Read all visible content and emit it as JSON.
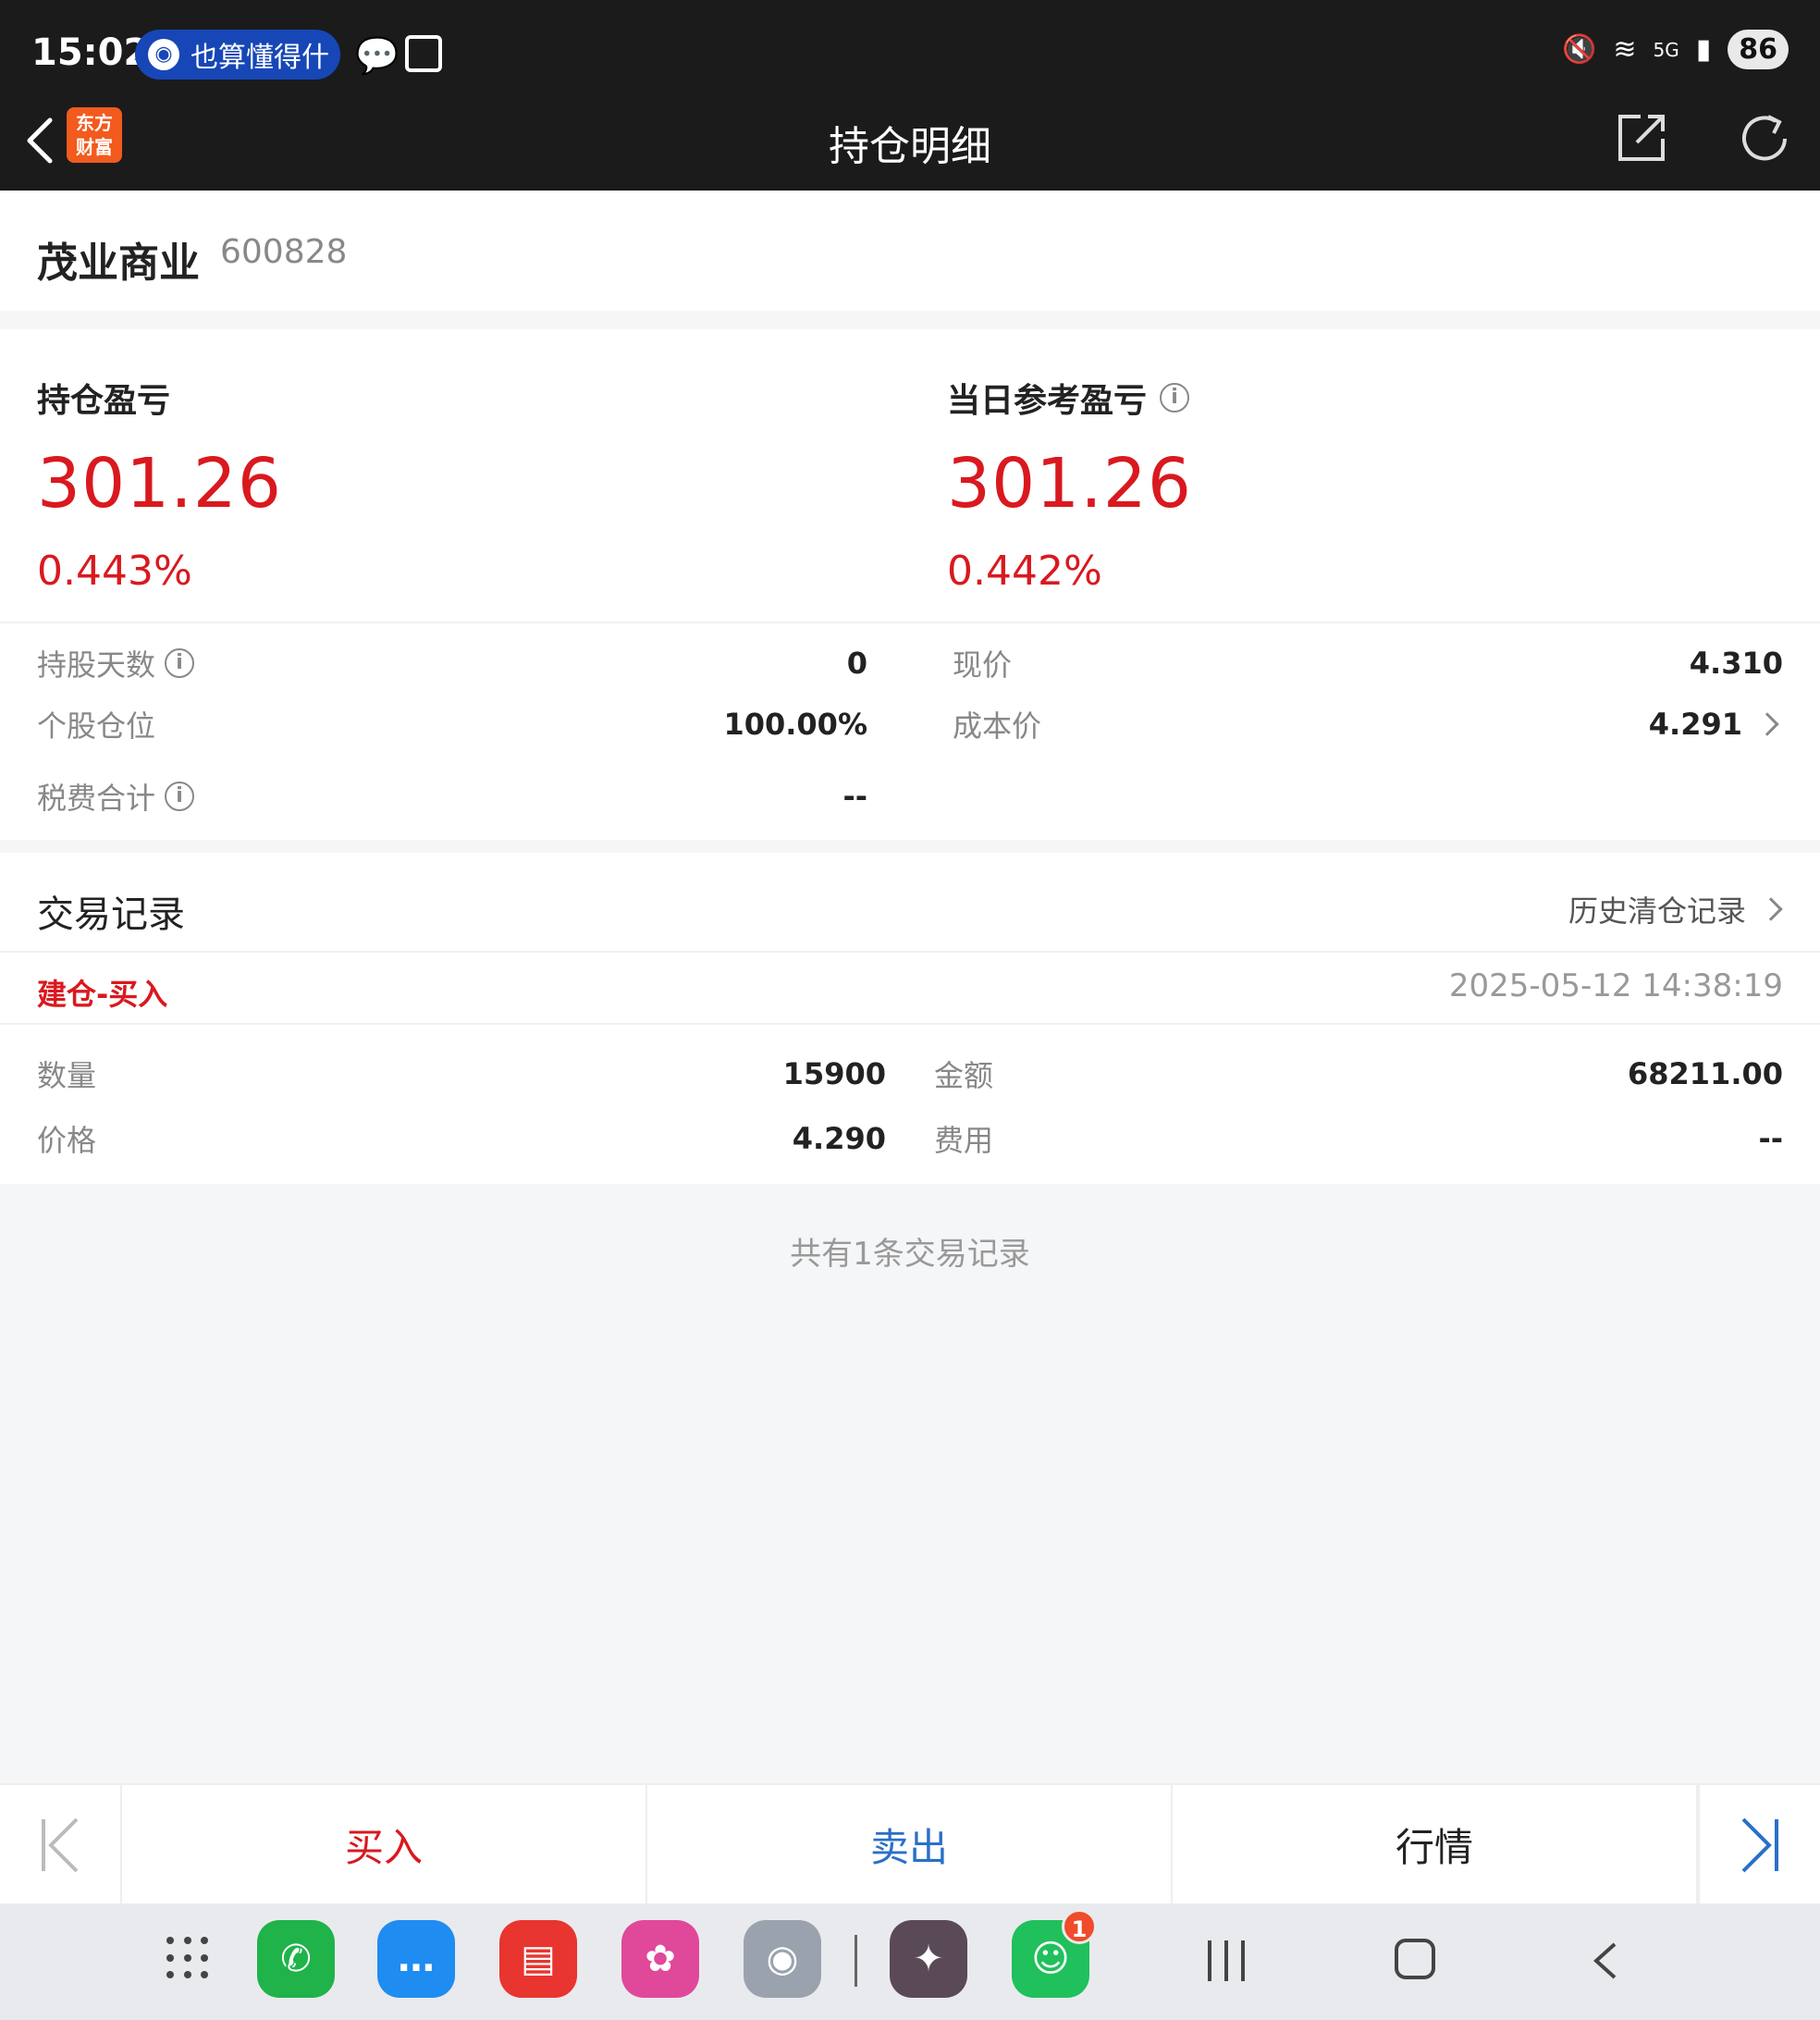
{
  "status_bar": {
    "time": "15:02",
    "pill_text": "也算懂得什",
    "battery": "86",
    "signal": "5G"
  },
  "header": {
    "title": "持仓明细",
    "logo_text_line1": "东方",
    "logo_text_line2": "财富"
  },
  "stock": {
    "name": "茂业商业",
    "code": "600828"
  },
  "pnl": {
    "holding_label": "持仓盈亏",
    "holding_value": "301.26",
    "holding_pct": "0.443%",
    "daily_label": "当日参考盈亏",
    "daily_value": "301.26",
    "daily_pct": "0.442%"
  },
  "details": {
    "holding_days_label": "持股天数",
    "holding_days_value": "0",
    "position_label": "个股仓位",
    "position_value": "100.00%",
    "tax_label": "税费合计",
    "tax_value": "--",
    "price_label": "现价",
    "price_value": "4.310",
    "cost_label": "成本价",
    "cost_value": "4.291"
  },
  "trades": {
    "title": "交易记录",
    "history_link": "历史清仓记录",
    "records": [
      {
        "type": "建仓-买入",
        "time": "2025-05-12 14:38:19",
        "qty_label": "数量",
        "qty": "15900",
        "amount_label": "金额",
        "amount": "68211.00",
        "price_label": "价格",
        "price": "4.290",
        "fee_label": "费用",
        "fee": "--"
      }
    ],
    "footer": "共有1条交易记录"
  },
  "actions": {
    "buy": "买入",
    "sell": "卖出",
    "quote": "行情"
  },
  "colors": {
    "gain": "#d9191f",
    "buy": "#d9191f",
    "sell": "#2a6fc9",
    "header_bg": "#1b1b1b"
  },
  "dock": {
    "wechat_badge": "1"
  }
}
